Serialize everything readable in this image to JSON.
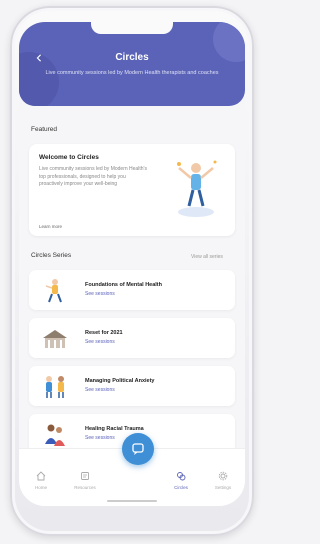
{
  "header": {
    "title": "Circles",
    "subtitle": "Live community sessions led by Modern Health therapists and coaches"
  },
  "featured": {
    "section_label": "Featured",
    "card_title": "Welcome to Circles",
    "card_desc": "Live community sessions led by Modern Health's top professionals, designed to help you proactively improve your well-being",
    "card_link": "Learn more"
  },
  "series": {
    "section_label": "Circles Series",
    "see_all": "View all series",
    "items": [
      {
        "title": "Foundations of Mental Health",
        "sub": "See sessions",
        "icon": "person-meditating-icon"
      },
      {
        "title": "Reset for 2021",
        "sub": "See sessions",
        "icon": "building-icon"
      },
      {
        "title": "Managing Political Anxiety",
        "sub": "See sessions",
        "icon": "people-talking-icon"
      },
      {
        "title": "Healing Racial Trauma",
        "sub": "See sessions",
        "icon": "people-group-icon"
      }
    ]
  },
  "tabbar": {
    "items": [
      {
        "label": "Home",
        "icon": "home-icon"
      },
      {
        "label": "Resources",
        "icon": "resources-icon"
      },
      {
        "label": "Circles",
        "icon": "circles-icon",
        "active": true
      },
      {
        "label": "Settings",
        "icon": "settings-icon"
      }
    ],
    "fab_icon": "chat-icon"
  },
  "colors": {
    "primary": "#5b63b8",
    "fab": "#3e8fd6"
  }
}
